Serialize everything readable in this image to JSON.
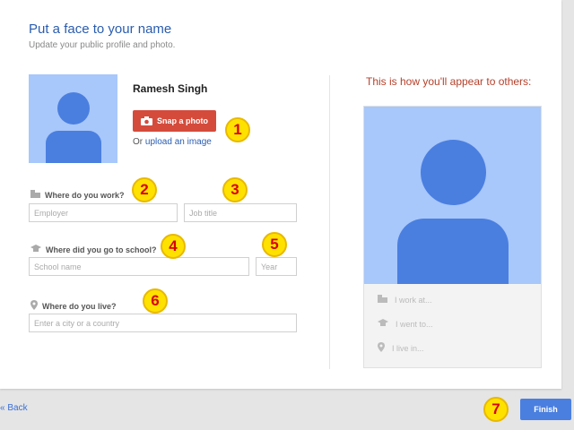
{
  "header": {
    "title": "Put a face to your name",
    "subtitle": "Update your public profile and photo."
  },
  "profile": {
    "name": "Ramesh Singh",
    "snap_button": "Snap a photo",
    "upload_prefix": "Or",
    "upload_link": "upload an image"
  },
  "form": {
    "work": {
      "label": "Where do you work?",
      "employer_placeholder": "Employer",
      "title_placeholder": "Job title"
    },
    "school": {
      "label": "Where did you go to school?",
      "school_placeholder": "School name",
      "year_placeholder": "Year"
    },
    "live": {
      "label": "Where do you live?",
      "city_placeholder": "Enter a city or a country"
    }
  },
  "preview": {
    "title": "This is how you'll appear to others:",
    "work_line": "I work at...",
    "school_line": "I went to...",
    "live_line": "I live in..."
  },
  "annotations": [
    "1",
    "2",
    "3",
    "4",
    "5",
    "6",
    "7"
  ],
  "footer": {
    "back": "« Back",
    "finish": "Finish"
  },
  "colors": {
    "accent": "#4a7fe0",
    "snap": "#d54b3b",
    "avatar_bg": "#a8c7fa",
    "badge": "#ffe100",
    "badge_text": "#d8000c"
  },
  "icons": [
    "camera-icon",
    "building-icon",
    "graduation-cap-icon",
    "location-pin-icon"
  ]
}
